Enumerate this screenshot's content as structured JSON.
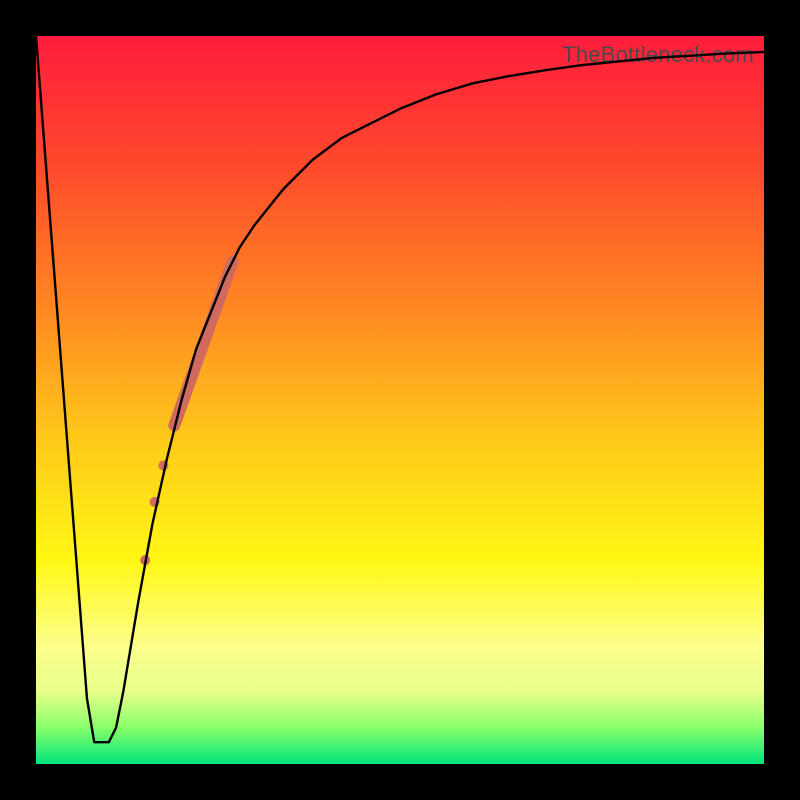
{
  "watermark": "TheBottleneck.com",
  "chart_data": {
    "type": "line",
    "title": "",
    "xlabel": "",
    "ylabel": "",
    "xlim": [
      0,
      100
    ],
    "ylim": [
      0,
      100
    ],
    "grid": false,
    "legend": false,
    "background_gradient": {
      "direction": "vertical",
      "stops": [
        {
          "pos": 0.0,
          "color": "#ff1c3c"
        },
        {
          "pos": 0.18,
          "color": "#ff4a2c"
        },
        {
          "pos": 0.38,
          "color": "#ff8a22"
        },
        {
          "pos": 0.55,
          "color": "#ffc81a"
        },
        {
          "pos": 0.72,
          "color": "#fff714"
        },
        {
          "pos": 0.84,
          "color": "#fdff8d"
        },
        {
          "pos": 0.9,
          "color": "#e8ff8a"
        },
        {
          "pos": 0.95,
          "color": "#88ff6a"
        },
        {
          "pos": 1.0,
          "color": "#00e47a"
        }
      ]
    },
    "series": [
      {
        "name": "bottleneck-curve",
        "color": "#000000",
        "width": 2.4,
        "x": [
          0,
          2,
          4,
          6,
          7,
          8,
          9,
          10,
          11,
          12,
          14,
          16,
          18,
          20,
          22,
          24,
          26,
          28,
          30,
          34,
          38,
          42,
          46,
          50,
          55,
          60,
          65,
          70,
          75,
          80,
          85,
          90,
          95,
          100
        ],
        "y": [
          100,
          74,
          48,
          22,
          9,
          3,
          3,
          3,
          5,
          10,
          22,
          33,
          42,
          50,
          57,
          62,
          67,
          71,
          74,
          79,
          83,
          86,
          88,
          90,
          92,
          93.5,
          94.5,
          95.3,
          96,
          96.5,
          97,
          97.3,
          97.6,
          97.8
        ]
      }
    ],
    "markers": [
      {
        "name": "highlight-segment",
        "type": "thick-line",
        "color": "#d06a5f",
        "width": 12,
        "x": [
          19,
          27
        ],
        "y": [
          46.5,
          69
        ]
      },
      {
        "name": "highlight-dots",
        "type": "scatter",
        "color": "#d06a5f",
        "size": 10,
        "points": [
          {
            "x": 17.5,
            "y": 41
          },
          {
            "x": 16.3,
            "y": 36
          },
          {
            "x": 15.0,
            "y": 28
          }
        ]
      }
    ]
  }
}
